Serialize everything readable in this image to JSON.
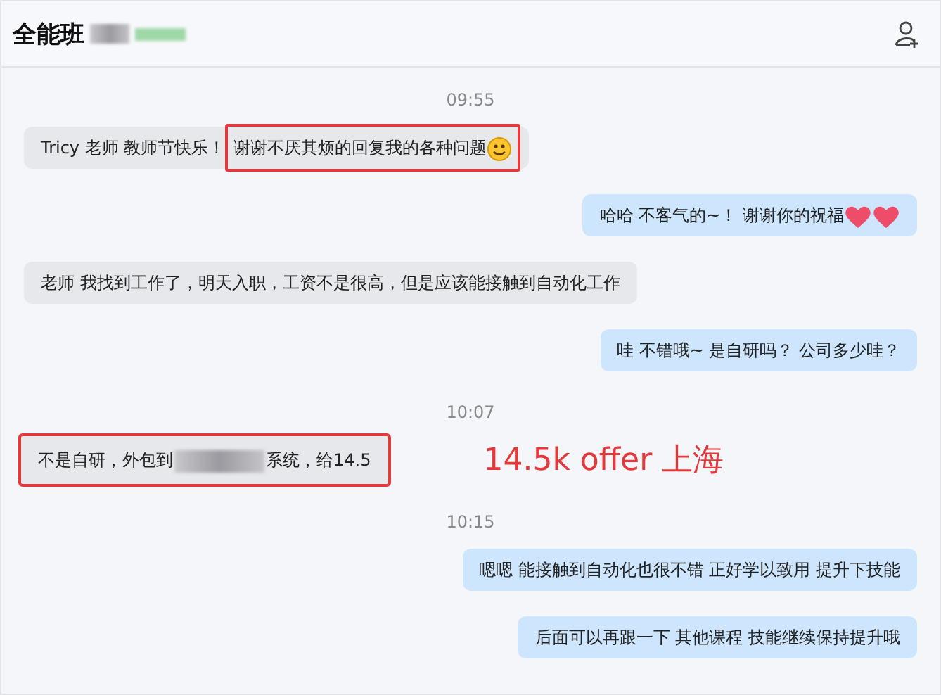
{
  "header": {
    "title": "全能班",
    "redacted": true
  },
  "messages": [
    {
      "kind": "time",
      "text": "09:55"
    },
    {
      "kind": "incoming",
      "segments": [
        {
          "text": "Tricy 老师 教师节快乐！",
          "highlighted": false
        },
        {
          "text": "谢谢不厌其烦的回复我的各种问题",
          "highlighted": true,
          "emojis": [
            {
              "kind": "smiley"
            }
          ]
        }
      ]
    },
    {
      "kind": "outgoing",
      "segments": [
        {
          "text": "哈哈 不客气的~！ 谢谢你的祝福",
          "highlighted": false,
          "emojis": [
            {
              "kind": "heart"
            },
            {
              "kind": "heart"
            }
          ]
        }
      ]
    },
    {
      "kind": "incoming",
      "segments": [
        {
          "text": "老师 我找到工作了，明天入职，工资不是很高，但是应该能接触到自动化工作",
          "highlighted": false
        }
      ]
    },
    {
      "kind": "outgoing",
      "segments": [
        {
          "text": "哇  不错哦~  是自研吗？ 公司多少哇？",
          "highlighted": false
        }
      ]
    },
    {
      "kind": "time",
      "text": "10:07"
    },
    {
      "kind": "incoming",
      "highlighted": true,
      "note": "14.5k offer 上海",
      "segments": [
        {
          "text": "不是自研，外包到",
          "highlighted": false
        },
        {
          "kind": "redaction"
        },
        {
          "text": "系统，给14.5",
          "highlighted": false
        }
      ]
    },
    {
      "kind": "time",
      "text": "10:15"
    },
    {
      "kind": "outgoing",
      "segments": [
        {
          "text": "嗯嗯  能接触到自动化也很不错  正好学以致用  提升下技能",
          "highlighted": false
        }
      ]
    },
    {
      "kind": "outgoing",
      "segments": [
        {
          "text": "后面可以再跟一下 其他课程  技能继续保持提升哦",
          "highlighted": false
        }
      ]
    }
  ]
}
